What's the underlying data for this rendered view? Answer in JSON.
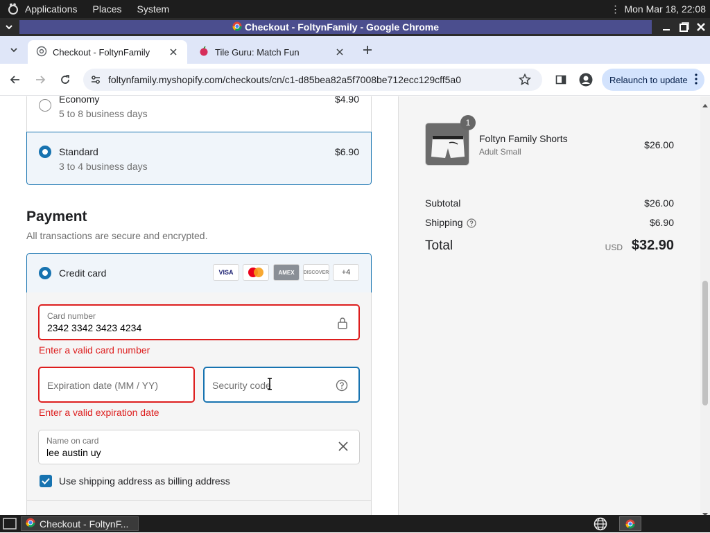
{
  "gnome_panel": {
    "menus": [
      "Applications",
      "Places",
      "System"
    ],
    "datetime": "Mon Mar 18, 22:08"
  },
  "window": {
    "title": "Checkout - FoltynFamily - Google Chrome"
  },
  "tabs": [
    {
      "label": "Checkout - FoltynFamily",
      "active": true
    },
    {
      "label": "Tile Guru: Match Fun",
      "active": false
    }
  ],
  "toolbar": {
    "url": "foltynfamily.myshopify.com/checkouts/cn/c1-d85bea82a5f7008be712ecc129cff5a0",
    "relaunch_label": "Relaunch to update"
  },
  "shipping": {
    "economy": {
      "name": "Economy",
      "eta": "5 to 8 business days",
      "price": "$4.90"
    },
    "standard": {
      "name": "Standard",
      "eta": "3 to 4 business days",
      "price": "$6.90"
    }
  },
  "payment": {
    "heading": "Payment",
    "subheading": "All transactions are secure and encrypted.",
    "method_label": "Credit card",
    "card_logos": [
      "VISA",
      "Mastercard",
      "AMEX",
      "DISCOVER"
    ],
    "more_logos": "+4",
    "card_number": {
      "label": "Card number",
      "value": "2342 3342 3423 4234",
      "error": "Enter a valid card number"
    },
    "expiry": {
      "placeholder": "Expiration date (MM / YY)",
      "error": "Enter a valid expiration date"
    },
    "security": {
      "placeholder": "Security code"
    },
    "name_on_card": {
      "label": "Name on card",
      "value": "lee austin uy"
    },
    "billing_checkbox": "Use shipping address as billing address"
  },
  "summary": {
    "item": {
      "name": "Foltyn Family Shorts",
      "variant": "Adult Small",
      "price": "$26.00",
      "qty": "1"
    },
    "subtotal_label": "Subtotal",
    "subtotal": "$26.00",
    "shipping_label": "Shipping",
    "shipping": "$6.90",
    "total_label": "Total",
    "currency": "USD",
    "total": "$32.90"
  },
  "taskbar": {
    "task_label": "Checkout - FoltynF..."
  },
  "colors": {
    "accent": "#1773b0",
    "error": "#dd1d1d"
  }
}
